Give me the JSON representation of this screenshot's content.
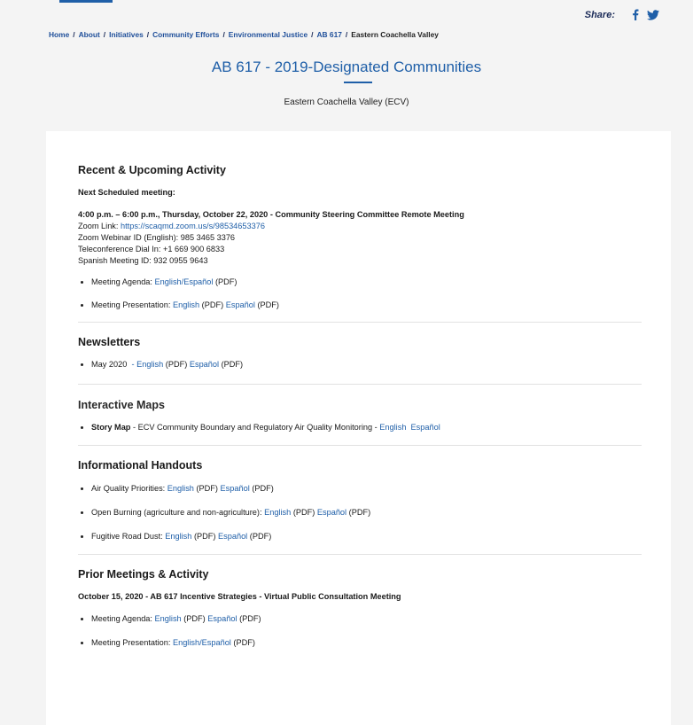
{
  "share": {
    "label": "Share:"
  },
  "breadcrumb": {
    "items": [
      "Home",
      "About",
      "Initiatives",
      "Community Efforts",
      "Environmental Justice",
      "AB 617"
    ],
    "current": "Eastern Coachella Valley",
    "separator": "/"
  },
  "page": {
    "title": "AB 617 - 2019-Designated Communities",
    "subtitle": "Eastern Coachella Valley (ECV)"
  },
  "recent": {
    "heading": "Recent & Upcoming Activity",
    "next_label": "Next Scheduled meeting:",
    "meeting_title": "4:00 p.m. – 6:00 p.m., Thursday, October 22, 2020 - Community Steering Committee Remote Meeting",
    "zoom_label": "Zoom Link:",
    "zoom_url": "https://scaqmd.zoom.us/s/98534653376",
    "webinar_id": "Zoom Webinar ID (English): 985 3465 3376",
    "dial_in": "Teleconference Dial In: +1 669 900 6833",
    "spanish_id": "Spanish Meeting ID: 932 0955 9643",
    "agenda_label": "Meeting Agenda:",
    "agenda_link": "English/Español",
    "agenda_suffix": "(PDF)",
    "presentation_label": "Meeting Presentation:",
    "pres_english": "English",
    "pres_english_suffix": "(PDF)",
    "pres_espanol": "Español",
    "pres_espanol_suffix": "(PDF)"
  },
  "newsletters": {
    "heading": "Newsletters",
    "item_label": "May 2020",
    "english": "- English",
    "english_suffix": "(PDF)",
    "espanol": "Español",
    "espanol_suffix": "(PDF)"
  },
  "maps": {
    "heading": "Interactive Maps",
    "story_label": "Story Map",
    "story_desc": "- ECV Community Boundary and Regulatory Air Quality Monitoring -",
    "english": "English",
    "espanol": "Español"
  },
  "handouts": {
    "heading": "Informational Handouts",
    "items": [
      {
        "label": "Air Quality Priorities:",
        "english": "English",
        "en_suffix": "(PDF)",
        "espanol": "Español",
        "es_suffix": "(PDF)"
      },
      {
        "label": "Open Burning (agriculture and non-agriculture):",
        "english": "English",
        "en_suffix": "(PDF)",
        "espanol": "Español",
        "es_suffix": "(PDF)"
      },
      {
        "label": "Fugitive Road Dust:",
        "english": "English",
        "en_suffix": "(PDF)",
        "espanol": "Español",
        "es_suffix": "(PDF)"
      }
    ]
  },
  "prior": {
    "heading": "Prior Meetings & Activity",
    "meeting_title": "October 15, 2020 - AB 617 Incentive Strategies - Virtual Public Consultation Meeting",
    "agenda_label": "Meeting Agenda:",
    "agenda_english": "English",
    "agenda_en_suffix": "(PDF)",
    "agenda_espanol": "Español",
    "agenda_es_suffix": "(PDF)",
    "presentation_label": "Meeting Presentation:",
    "presentation_link": "English/Español",
    "presentation_suffix": "(PDF)"
  },
  "colors": {
    "link": "#1f5fa8",
    "title": "#1f5fa8",
    "nav": "#1a2a57",
    "background": "#f4f4f4"
  },
  "icons": [
    "facebook-icon",
    "twitter-icon"
  ]
}
